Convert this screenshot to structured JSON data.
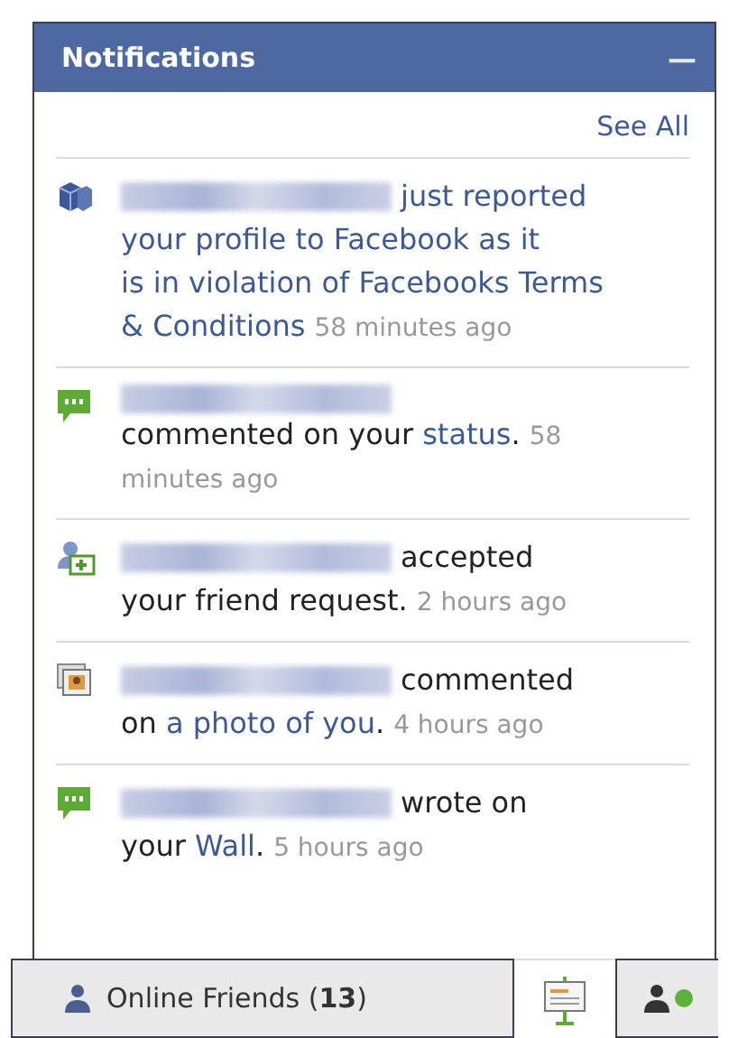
{
  "panel": {
    "title": "Notifications",
    "minimize": "—",
    "see_all": "See All"
  },
  "notifications": [
    {
      "kind": "report",
      "lines": [
        [
          {
            "kind": "name"
          },
          {
            "kind": "link",
            "text": "just reported"
          }
        ],
        [
          {
            "kind": "link",
            "text": "your profile to Facebook as it"
          }
        ],
        [
          {
            "kind": "link",
            "text": "is in violation of Facebooks Terms"
          }
        ],
        [
          {
            "kind": "link",
            "text": "& Conditions"
          },
          {
            "kind": "time",
            "text": "58 minutes ago"
          }
        ]
      ]
    },
    {
      "kind": "comment",
      "lines": [
        [
          {
            "kind": "name"
          }
        ],
        [
          {
            "kind": "plain",
            "text": "commented on your"
          },
          {
            "kind": "link",
            "text": "status"
          },
          {
            "kind": "punct",
            "text": "."
          },
          {
            "kind": "time",
            "text": "58"
          }
        ],
        [
          {
            "kind": "time",
            "text": "minutes ago"
          }
        ]
      ]
    },
    {
      "kind": "friend",
      "lines": [
        [
          {
            "kind": "name"
          },
          {
            "kind": "plain",
            "text": "accepted"
          }
        ],
        [
          {
            "kind": "plain",
            "text": "your friend request."
          },
          {
            "kind": "time",
            "text": "2 hours ago"
          }
        ]
      ]
    },
    {
      "kind": "photo",
      "lines": [
        [
          {
            "kind": "name"
          },
          {
            "kind": "plain",
            "text": "commented"
          }
        ],
        [
          {
            "kind": "plain",
            "text": "on"
          },
          {
            "kind": "link",
            "text": "a photo of you"
          },
          {
            "kind": "punct",
            "text": "."
          },
          {
            "kind": "time",
            "text": "4 hours ago"
          }
        ]
      ]
    },
    {
      "kind": "comment",
      "lines": [
        [
          {
            "kind": "name"
          },
          {
            "kind": "plain",
            "text": "wrote on"
          }
        ],
        [
          {
            "kind": "plain",
            "text": "your"
          },
          {
            "kind": "link",
            "text": "Wall"
          },
          {
            "kind": "punct",
            "text": "."
          },
          {
            "kind": "time",
            "text": "5 hours ago"
          }
        ]
      ]
    }
  ],
  "bottom_bar": {
    "online_friends": "Online Friends (**13**)",
    "status_online": true
  }
}
